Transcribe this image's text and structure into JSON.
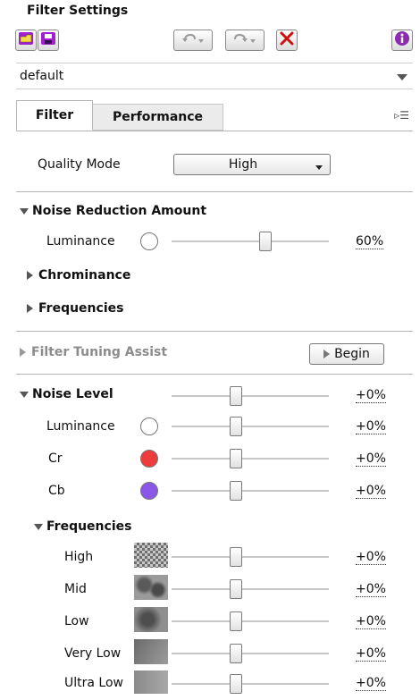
{
  "header": {
    "title": "Filter Settings"
  },
  "toolbar": {
    "buttons": [
      {
        "icon": "open-folder-icon",
        "color": "#a21fd0"
      },
      {
        "icon": "save-icon",
        "color": "#a21fd0"
      },
      {
        "icon": "undo-icon",
        "color": "#8a8a8a"
      },
      {
        "icon": "redo-icon",
        "color": "#8a8a8a"
      },
      {
        "icon": "close-icon",
        "color": "#cc1111"
      },
      {
        "icon": "info-icon",
        "color": "#8a2bb0"
      }
    ]
  },
  "preset": {
    "value": "default"
  },
  "tabs": [
    {
      "label": "Filter",
      "active": true
    },
    {
      "label": "Performance",
      "active": false
    }
  ],
  "quality": {
    "label": "Quality Mode",
    "value": "High"
  },
  "noise_reduction": {
    "title": "Noise Reduction Amount",
    "luminance": {
      "label": "Luminance",
      "value": "60%",
      "level": 0.6
    },
    "chrominance_label": "Chrominance",
    "frequencies_label": "Frequencies"
  },
  "tuning": {
    "title": "Filter Tuning Assist",
    "button_label": "Begin"
  },
  "noise_level": {
    "title": "Noise Level",
    "value": "+0%",
    "channels": [
      {
        "label": "Luminance",
        "value": "+0%",
        "color": "#ffffff"
      },
      {
        "label": "Cr",
        "value": "+0%",
        "color": "#ee3b3b"
      },
      {
        "label": "Cb",
        "value": "+0%",
        "color": "#8a57e8"
      }
    ]
  },
  "frequencies": {
    "title": "Frequencies",
    "items": [
      {
        "label": "High",
        "value": "+0%"
      },
      {
        "label": "Mid",
        "value": "+0%"
      },
      {
        "label": "Low",
        "value": "+0%"
      },
      {
        "label": "Very Low",
        "value": "+0%"
      },
      {
        "label": "Ultra Low",
        "value": "+0%"
      }
    ]
  }
}
